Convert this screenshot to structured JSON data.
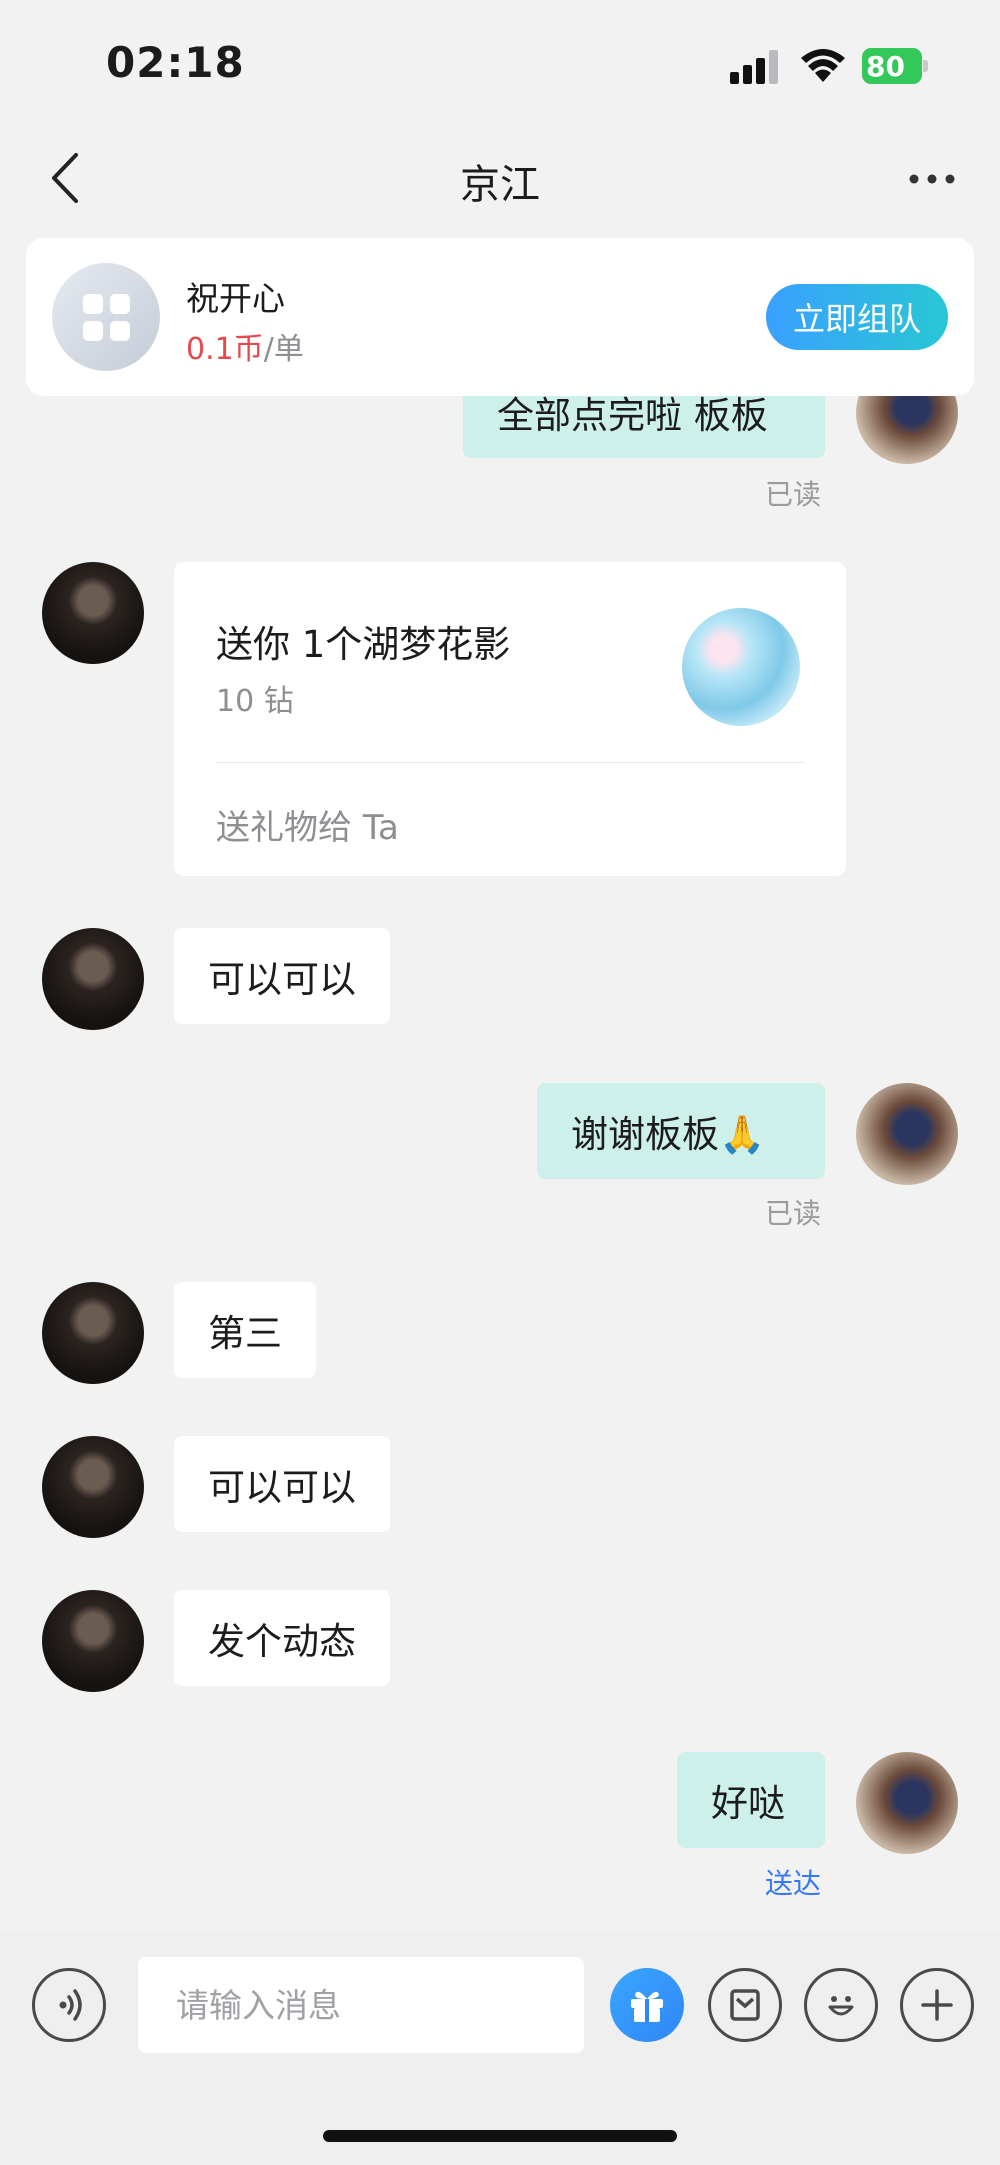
{
  "status_bar": {
    "time": "02:18",
    "battery": "80"
  },
  "header": {
    "title": "京江"
  },
  "service_card": {
    "name": "祝开心",
    "price_value": "0.1币",
    "price_unit": "/单",
    "team_button": "立即组队"
  },
  "messages": {
    "m0": {
      "text": "全部点完啦 板板",
      "status": "已读"
    },
    "gift": {
      "title": "送你 1个湖梦花影",
      "price": "10 钻",
      "action": "送礼物给 Ta"
    },
    "m1": {
      "text": "可以可以"
    },
    "m2": {
      "text": "谢谢板板🙏",
      "status": "已读"
    },
    "m3": {
      "text": "第三"
    },
    "m4": {
      "text": "可以可以"
    },
    "m5": {
      "text": "发个动态"
    },
    "m6": {
      "text": "好哒",
      "status": "送达"
    }
  },
  "input_bar": {
    "placeholder": "请输入消息"
  },
  "colors": {
    "accent": "#3aa0ff",
    "bubble_self": "#cdf0ea",
    "price_red": "#e8494e",
    "delivered_blue": "#3478f6"
  },
  "icons": [
    "back-icon",
    "more-icon",
    "grid-icon",
    "voice-icon",
    "gift-icon",
    "image-icon",
    "emoji-icon",
    "plus-icon"
  ]
}
